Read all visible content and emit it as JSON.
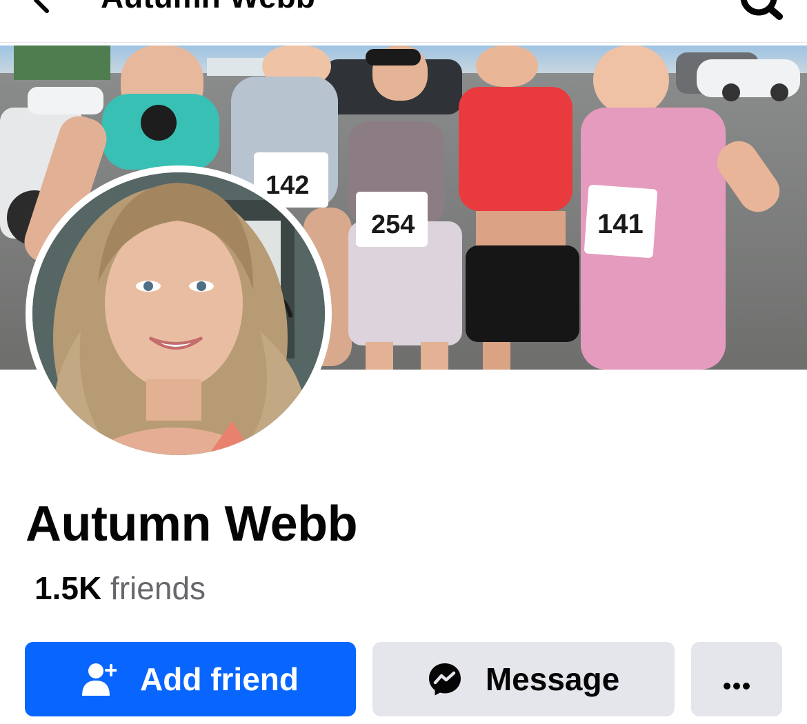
{
  "header": {
    "title": "Autumn Webb",
    "back_icon": "arrow-left-icon",
    "search_icon": "search-icon"
  },
  "cover": {
    "description_icon": "cover-photo",
    "bibs": [
      "142",
      "254",
      "141"
    ]
  },
  "profile": {
    "name": "Autumn Webb",
    "friends_count": "1.5K",
    "friends_label": "friends"
  },
  "actions": {
    "add_friend_label": "Add friend",
    "add_friend_icon": "add-friend-icon",
    "message_label": "Message",
    "message_icon": "messenger-icon",
    "more_icon": "more-dots-icon"
  },
  "colors": {
    "primary": "#0866ff",
    "secondary_button": "#e4e6eb",
    "secondary_text": "#65676b",
    "text": "#050505"
  }
}
